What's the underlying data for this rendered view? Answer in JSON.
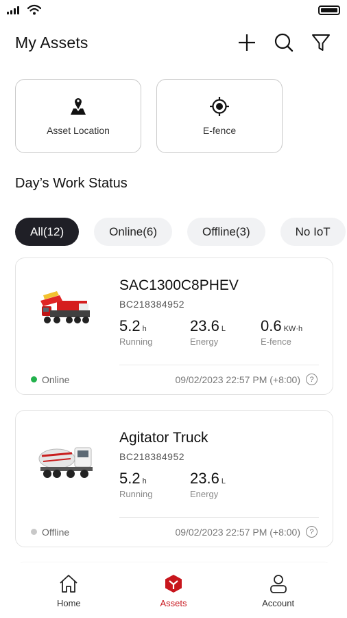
{
  "header": {
    "title": "My Assets",
    "icons": [
      "plus-icon",
      "search-icon",
      "filter-icon"
    ]
  },
  "tiles": [
    {
      "label": "Asset Location",
      "icon": "location-person-icon"
    },
    {
      "label": "E-fence",
      "icon": "target-icon"
    }
  ],
  "section_title": "Day’s Work Status",
  "filters": [
    {
      "label": "All(12)",
      "active": true
    },
    {
      "label": "Online(6)",
      "active": false
    },
    {
      "label": "Offline(3)",
      "active": false
    },
    {
      "label": "No IoT",
      "active": false
    }
  ],
  "assets": [
    {
      "name": "SAC1300C8PHEV",
      "id": "BC218384952",
      "image": "crane-truck",
      "metrics": [
        {
          "value": "5.2",
          "unit": "h",
          "label": "Running"
        },
        {
          "value": "23.6",
          "unit": "L",
          "label": "Energy"
        },
        {
          "value": "0.6",
          "unit": "KW·h",
          "label": "E-fence"
        }
      ],
      "status": "Online",
      "timestamp": "09/02/2023 22:57 PM (+8:00)"
    },
    {
      "name": "Agitator Truck",
      "id": "BC218384952",
      "image": "mixer-truck",
      "metrics": [
        {
          "value": "5.2",
          "unit": "h",
          "label": "Running"
        },
        {
          "value": "23.6",
          "unit": "L",
          "label": "Energy"
        }
      ],
      "status": "Offline",
      "timestamp": "09/02/2023 22:57 PM (+8:00)"
    }
  ],
  "bottom_nav": [
    {
      "label": "Home",
      "icon": "home-icon"
    },
    {
      "label": "Assets",
      "icon": "assets-icon",
      "active": true
    },
    {
      "label": "Account",
      "icon": "account-icon"
    }
  ],
  "colors": {
    "accent": "#c8161d",
    "online": "#22b14c",
    "offline": "#c8c8c8",
    "chip_active": "#1f1f26"
  }
}
